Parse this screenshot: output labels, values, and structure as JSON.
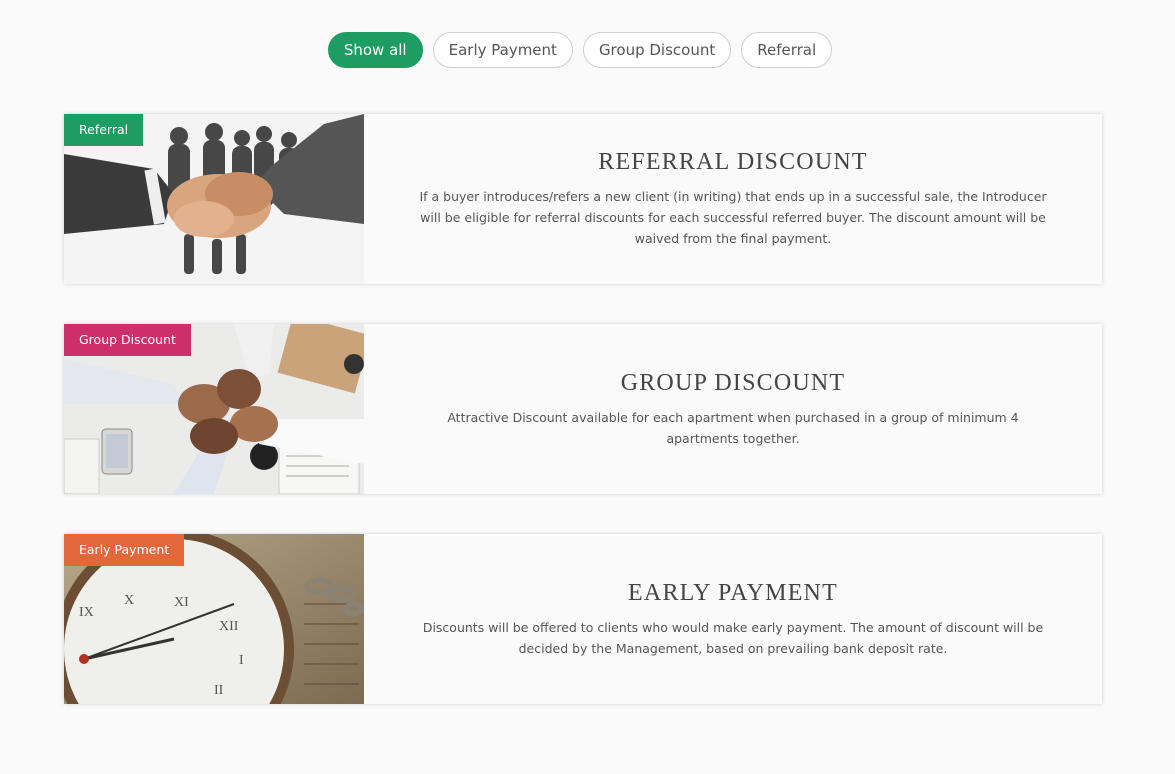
{
  "filters": {
    "show_all": "Show all",
    "early_payment": "Early Payment",
    "group_discount": "Group Discount",
    "referral": "Referral"
  },
  "accent_colors": {
    "active_filter": "#1e9d62",
    "referral_tag": "#1e9d62",
    "group_tag": "#cc2f6a",
    "early_tag": "#e2683c"
  },
  "cards": [
    {
      "tag": "Referral",
      "image": "handshake-image",
      "title": "REFERRAL DISCOUNT",
      "description": "If a buyer introduces/refers a new client (in writing) that ends up in a successful sale, the Introducer will be eligible for referral discounts for each successful referred buyer. The discount amount will be waived from the final payment."
    },
    {
      "tag": "Group Discount",
      "image": "fist-bump-image",
      "title": "GROUP DISCOUNT",
      "description": "Attractive Discount available for each apartment when purchased in a group of minimum 4 apartments together."
    },
    {
      "tag": "Early Payment",
      "image": "pocket-watch-image",
      "title": "EARLY PAYMENT",
      "description": "Discounts will be offered to clients who would make early payment. The amount of discount will be decided by the Management, based on prevailing bank deposit rate."
    }
  ]
}
